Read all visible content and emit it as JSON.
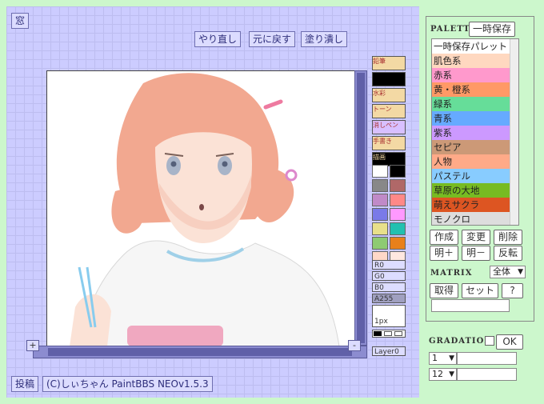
{
  "workspace": {
    "window_button": "窓",
    "redo": "やり直し",
    "undo": "元に戻す",
    "fill": "塗り潰し",
    "post": "投稿",
    "copyright": "(C)しぃちゃん PaintBBS NEOv1.5.3",
    "scroll_plus": "+",
    "scroll_minus": "-"
  },
  "tools": [
    "鉛筆",
    "",
    "水彩",
    "トーン",
    "消しペン",
    "手書き",
    "描画"
  ],
  "swatch_colors": [
    "#ffffff",
    "#000000",
    "#888888",
    "#b06868",
    "#c08ac8",
    "#ff8888",
    "#7a7ae8",
    "#ff99ff",
    "#e8e08a",
    "#22c0b0",
    "#8ecb72",
    "#e8801a",
    "#ffd8c8",
    "#ffe8e0"
  ],
  "color_values": {
    "r": "R0",
    "g": "G0",
    "b": "B0",
    "a": "A255"
  },
  "pen_size": "1px",
  "layer": "Layer0",
  "palette": {
    "title": "PALETTE",
    "save_temp": "一時保存",
    "items": [
      {
        "label": "一時保存パレット",
        "color": "#ffffff"
      },
      {
        "label": "肌色系",
        "color": "#ffd8c0"
      },
      {
        "label": "赤系",
        "color": "#ff99cc"
      },
      {
        "label": "黄・橙系",
        "color": "#ff9966"
      },
      {
        "label": "緑系",
        "color": "#66dd99"
      },
      {
        "label": "青系",
        "color": "#66aaff"
      },
      {
        "label": "紫系",
        "color": "#cc99ff"
      },
      {
        "label": "セピア",
        "color": "#cc9977"
      },
      {
        "label": "人物",
        "color": "#ffaa88"
      },
      {
        "label": "パステル",
        "color": "#88ccff"
      },
      {
        "label": "草原の大地",
        "color": "#77bb22"
      },
      {
        "label": "萌えサクラ",
        "color": "#dd5522"
      },
      {
        "label": "モノクロ",
        "color": "#dddddd"
      }
    ],
    "create": "作成",
    "change": "変更",
    "delete": "削除",
    "brighter": "明＋",
    "darker": "明－",
    "invert": "反転"
  },
  "matrix": {
    "title": "MATRIX",
    "select_value": "全体",
    "get": "取得",
    "set": "セット",
    "help": "?"
  },
  "gradation": {
    "title": "GRADATION",
    "ok": "OK",
    "start_value": "1",
    "end_value": "12"
  }
}
